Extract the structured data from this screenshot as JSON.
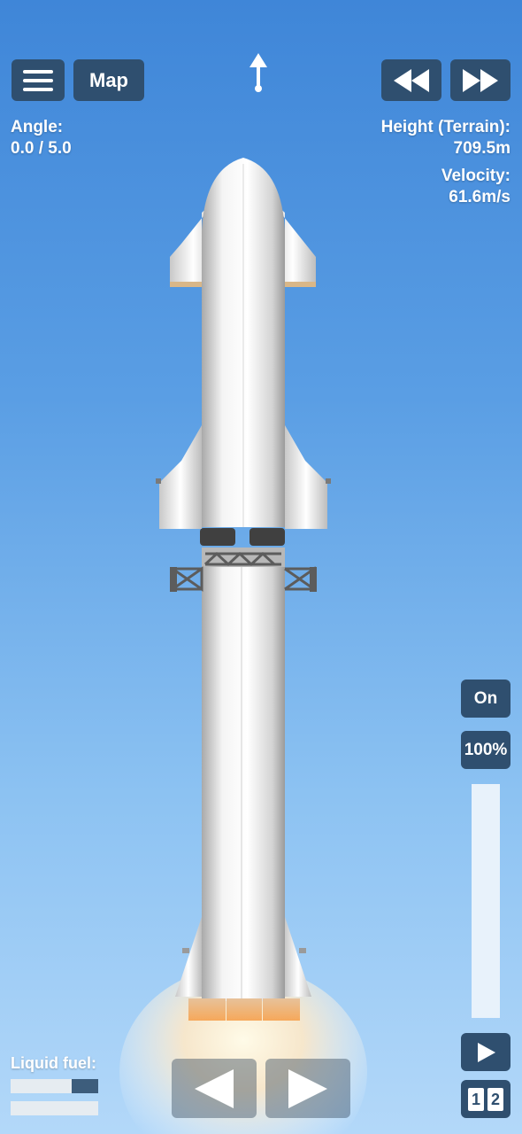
{
  "top_bar": {
    "map_label": "Map"
  },
  "readouts": {
    "angle_label": "Angle:",
    "angle_value": "0.0 / 5.0",
    "height_label": "Height (Terrain):",
    "height_value": "709.5m",
    "velocity_label": "Velocity:",
    "velocity_value": "61.6m/s"
  },
  "throttle": {
    "toggle_label": "On",
    "percent_label": "100%",
    "level": 1.0
  },
  "fuel": {
    "label": "Liquid fuel:",
    "stage_1_level": 0.7,
    "stage_2_level": 1.0
  },
  "stage_selector": {
    "stage_1": "1",
    "stage_2": "2"
  },
  "colors": {
    "button_bg": "#2f4f6f",
    "sky_top": "#3f86d8",
    "sky_bottom": "#b3d8f9"
  }
}
